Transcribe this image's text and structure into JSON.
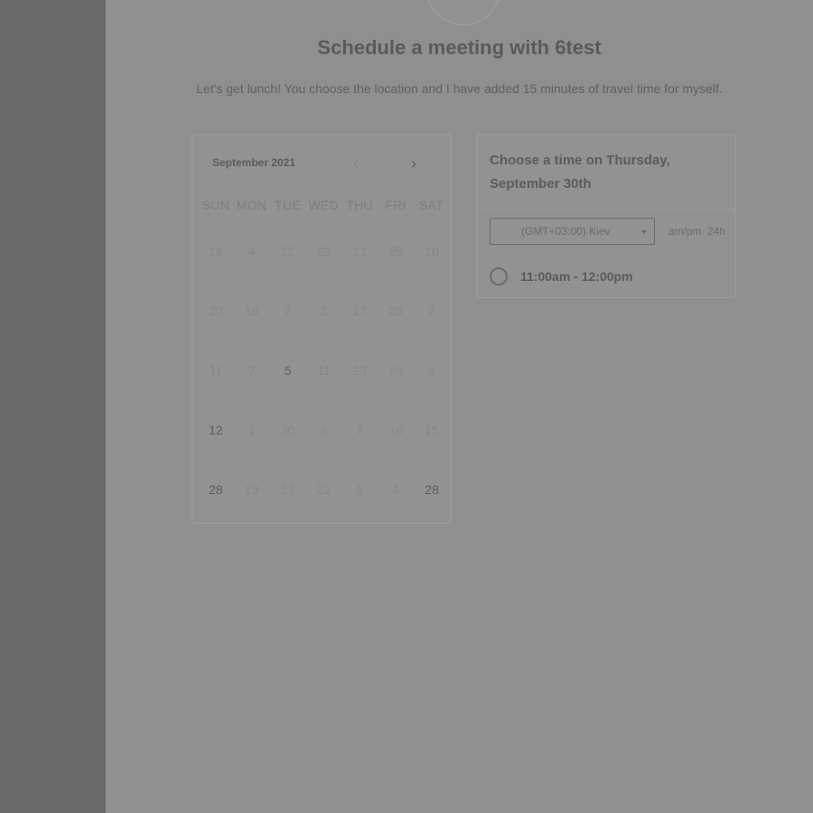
{
  "header": {
    "title": "Schedule a meeting with 6test",
    "subtitle": "Let's get lunch! You choose the location and I have added 15 minutes of travel time for myself."
  },
  "calendar": {
    "month_label": "September 2021",
    "prev_icon": "‹",
    "next_icon": "›",
    "weekdays": [
      "SUN",
      "MON",
      "TUE",
      "WED",
      "THU",
      "FRI",
      "SAT"
    ],
    "days": [
      {
        "label": "16",
        "dark": false
      },
      {
        "label": "4",
        "dark": false
      },
      {
        "label": "22",
        "dark": false
      },
      {
        "label": "22",
        "dark": false
      },
      {
        "label": "21",
        "dark": false
      },
      {
        "label": "29",
        "dark": false
      },
      {
        "label": "10",
        "dark": false
      },
      {
        "label": "20",
        "dark": false
      },
      {
        "label": "16",
        "dark": false
      },
      {
        "label": "7",
        "dark": false
      },
      {
        "label": "2",
        "dark": false
      },
      {
        "label": "17",
        "dark": false
      },
      {
        "label": "28",
        "dark": false
      },
      {
        "label": "2",
        "dark": false
      },
      {
        "label": "11",
        "dark": false
      },
      {
        "label": "7",
        "dark": false
      },
      {
        "label": "5",
        "dark": true
      },
      {
        "label": "11",
        "dark": false
      },
      {
        "label": "23",
        "dark": false
      },
      {
        "label": "24",
        "dark": false
      },
      {
        "label": "3",
        "dark": false
      },
      {
        "label": "12",
        "dark": true
      },
      {
        "label": "1",
        "dark": false
      },
      {
        "label": "30",
        "dark": false
      },
      {
        "label": "6",
        "dark": false
      },
      {
        "label": "7",
        "dark": false
      },
      {
        "label": "10",
        "dark": false
      },
      {
        "label": "15",
        "dark": false
      },
      {
        "label": "28",
        "dark": true
      },
      {
        "label": "19",
        "dark": false
      },
      {
        "label": "27",
        "dark": false
      },
      {
        "label": "22",
        "dark": false
      },
      {
        "label": "9",
        "dark": false
      },
      {
        "label": "4",
        "dark": false
      },
      {
        "label": "28",
        "dark": true
      }
    ]
  },
  "time_panel": {
    "heading": "Choose a time on Thursday, September 30th",
    "timezone_value": "(GMT+03:00) Kiev",
    "format_ampm": "am/pm",
    "format_24h": "24h",
    "slots": [
      {
        "label": "11:00am - 12:00pm"
      }
    ]
  },
  "colors": {
    "sidebar": "#6a6a6a",
    "main_bg": "#8f8f8f",
    "card_bg": "#929292",
    "text_dark": "#5a5a5a"
  }
}
